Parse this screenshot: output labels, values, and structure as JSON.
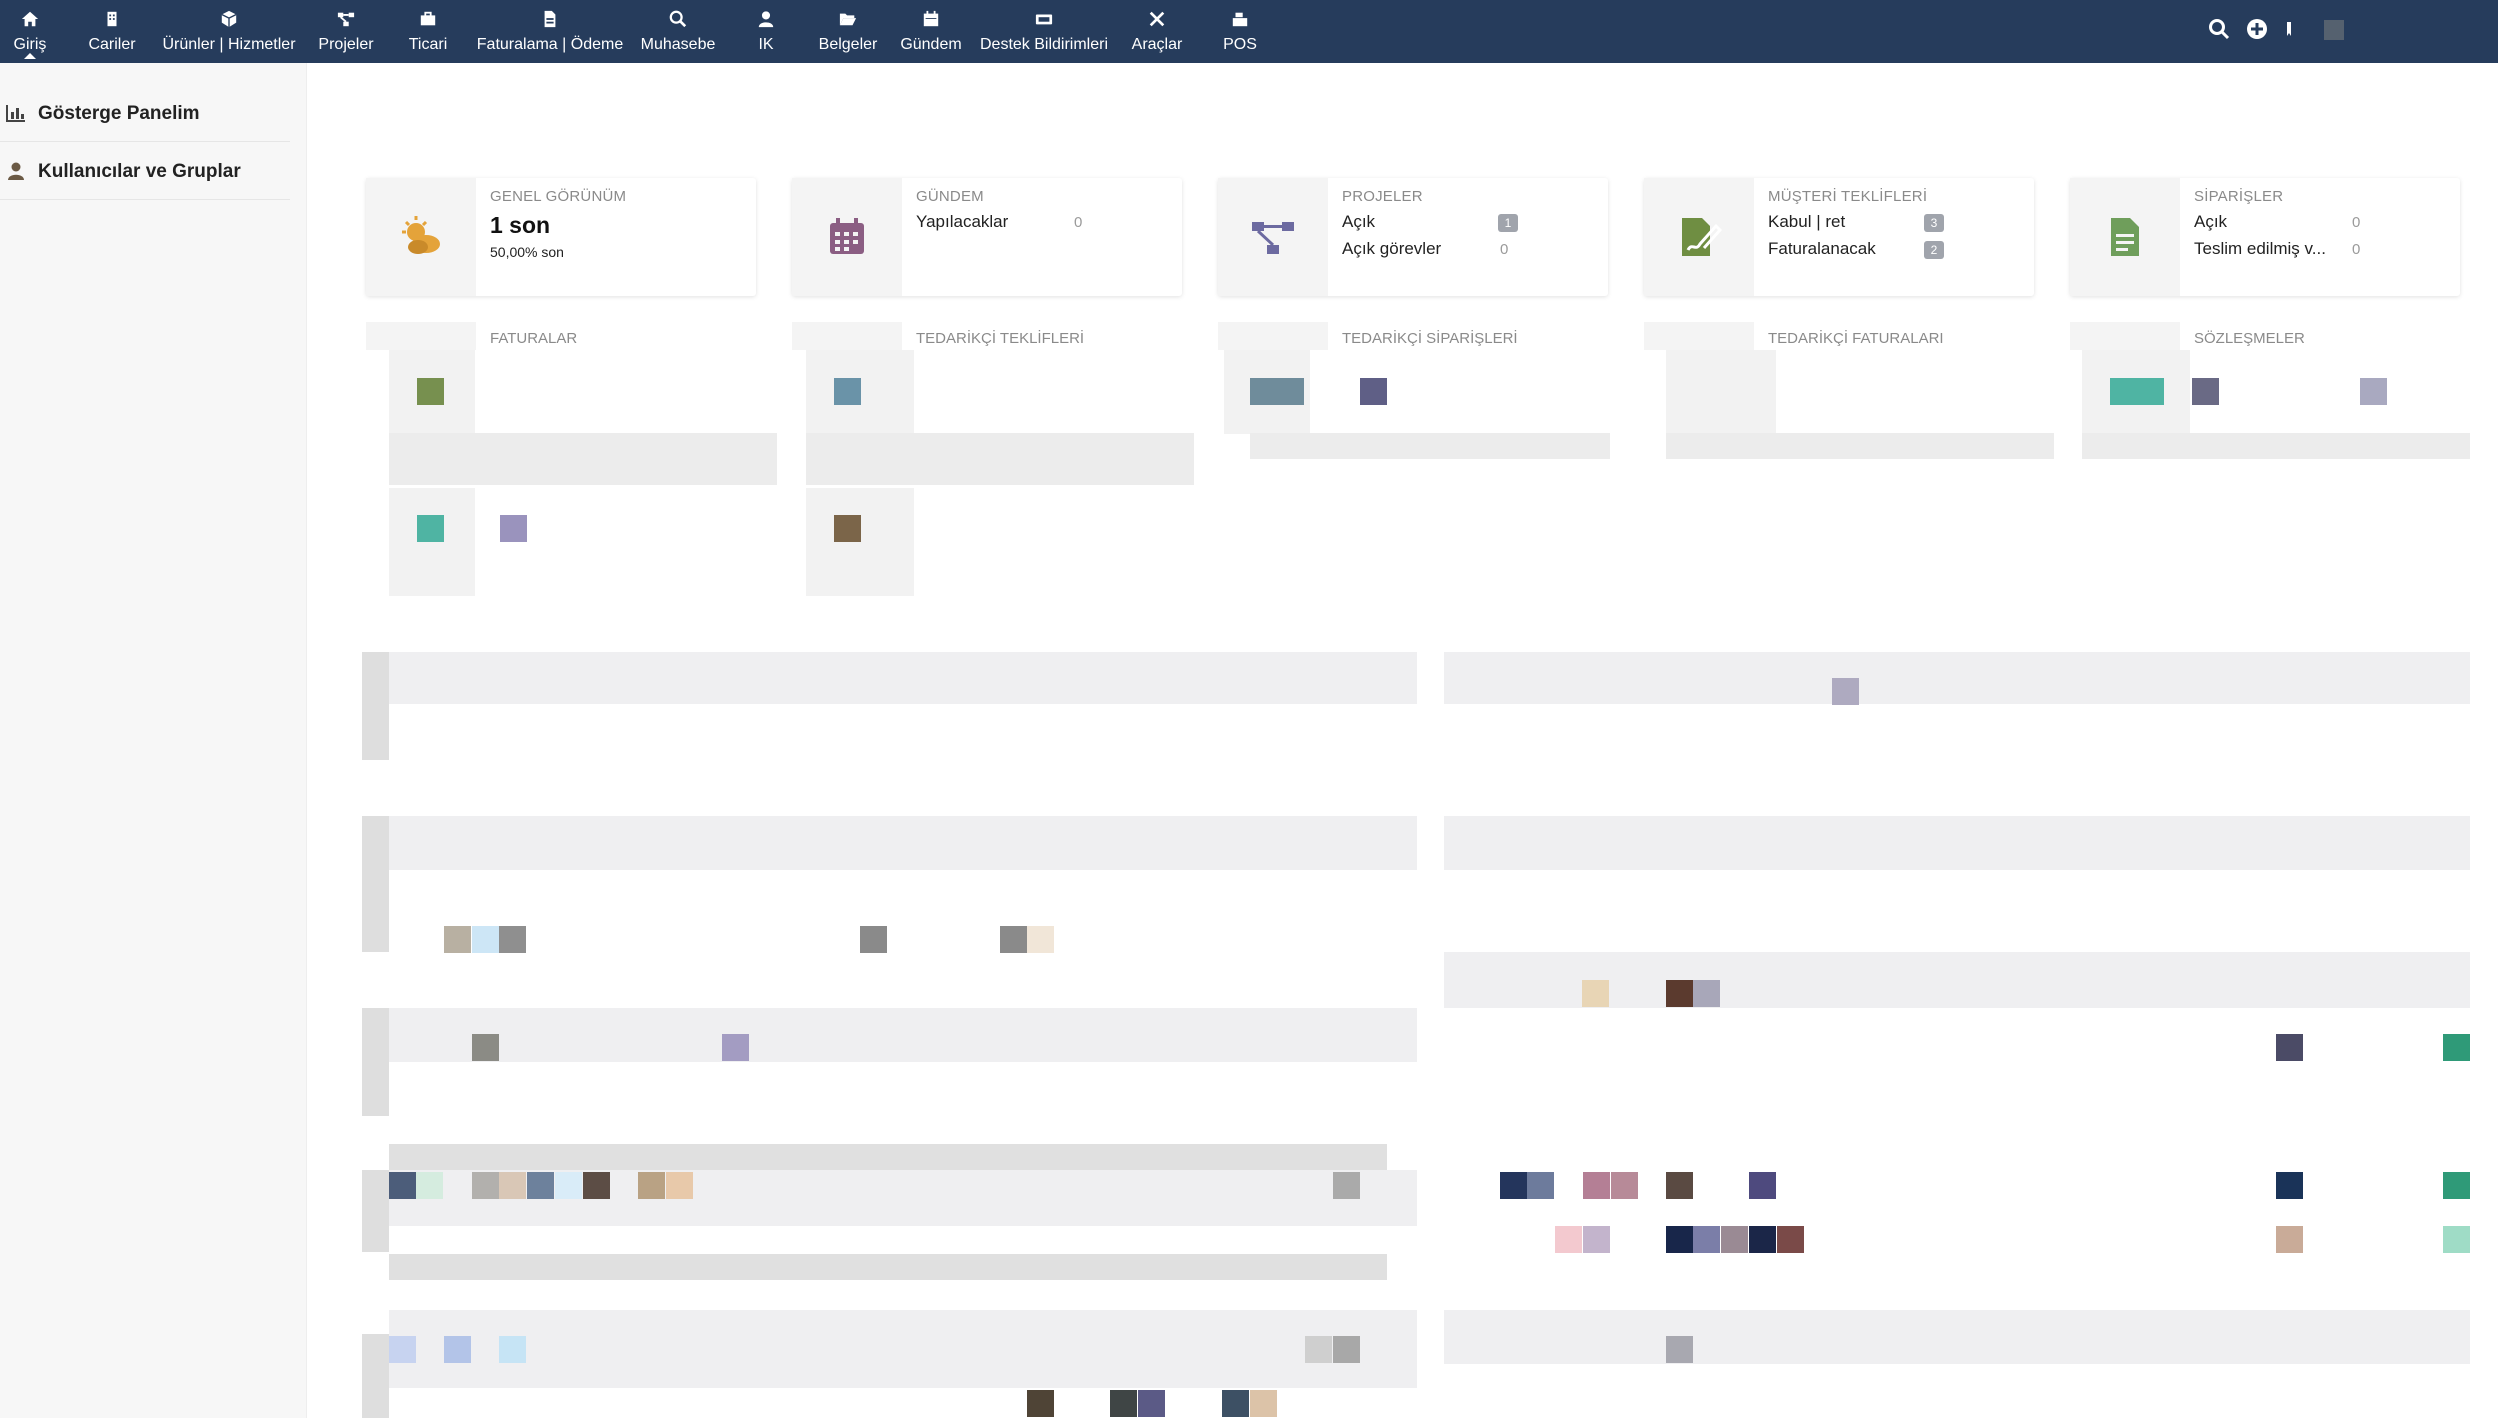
{
  "nav": {
    "items": [
      {
        "label": "Giriş",
        "icon": "home-icon"
      },
      {
        "label": "Cariler",
        "icon": "building-icon"
      },
      {
        "label": "Ürünler | Hizmetler",
        "icon": "cube-icon"
      },
      {
        "label": "Projeler",
        "icon": "sitemap-icon"
      },
      {
        "label": "Ticari",
        "icon": "briefcase-icon"
      },
      {
        "label": "Faturalama | Ödeme",
        "icon": "file-invoice-icon"
      },
      {
        "label": "Muhasebe",
        "icon": "search-dollar-icon"
      },
      {
        "label": "IK",
        "icon": "user-icon"
      },
      {
        "label": "Belgeler",
        "icon": "folder-open-icon"
      },
      {
        "label": "Gündem",
        "icon": "calendar-icon"
      },
      {
        "label": "Destek Bildirimleri",
        "icon": "ticket-icon"
      },
      {
        "label": "Araçlar",
        "icon": "tools-icon"
      },
      {
        "label": "POS",
        "icon": "cash-register-icon"
      }
    ],
    "active": "Giriş"
  },
  "sidebar": {
    "items": [
      {
        "label": "Gösterge Panelim",
        "icon": "chart-bar-icon"
      },
      {
        "label": "Kullanıcılar ve Gruplar",
        "icon": "user-icon"
      }
    ]
  },
  "boxes": {
    "general": {
      "title": "GENEL GÖRÜNÜM",
      "big": "1 son",
      "small": "50,00% son",
      "icon": "weather-cloud-sun-icon",
      "color": "#e4a33a"
    },
    "agenda": {
      "title": "GÜNDEM",
      "line1": "Yapılacaklar",
      "val1": "0",
      "icon": "calendar-icon",
      "color": "#8b5e83"
    },
    "projects": {
      "title": "PROJELER",
      "line1": "Açık",
      "val1": "1",
      "line2": "Açık görevler",
      "val2": "0",
      "icon": "sitemap-icon",
      "color": "#6c6aa0"
    },
    "proposals": {
      "title": "MÜŞTERİ TEKLİFLERİ",
      "line1": "Kabul | ret",
      "val1": "3",
      "line2": "Faturalanacak",
      "val2": "2",
      "icon": "file-signature-icon",
      "color": "#6f8e42"
    },
    "orders": {
      "title": "SİPARİŞLER",
      "line1": "Açık",
      "val1": "0",
      "line2": "Teslim edilmiş v...",
      "val2": "0",
      "icon": "file-text-icon",
      "color": "#6f9e5b"
    }
  },
  "boxes_row2": [
    {
      "title": "FATURALAR"
    },
    {
      "title": "TEDARİKÇİ TEKLİFLERİ"
    },
    {
      "title": "TEDARİKÇİ SİPARİŞLERİ"
    },
    {
      "title": "TEDARİKÇİ FATURALARI"
    },
    {
      "title": "SÖZLEŞMELER"
    }
  ],
  "colors": {
    "topbar": "#263c5c",
    "badge": "#a0a4ac"
  }
}
